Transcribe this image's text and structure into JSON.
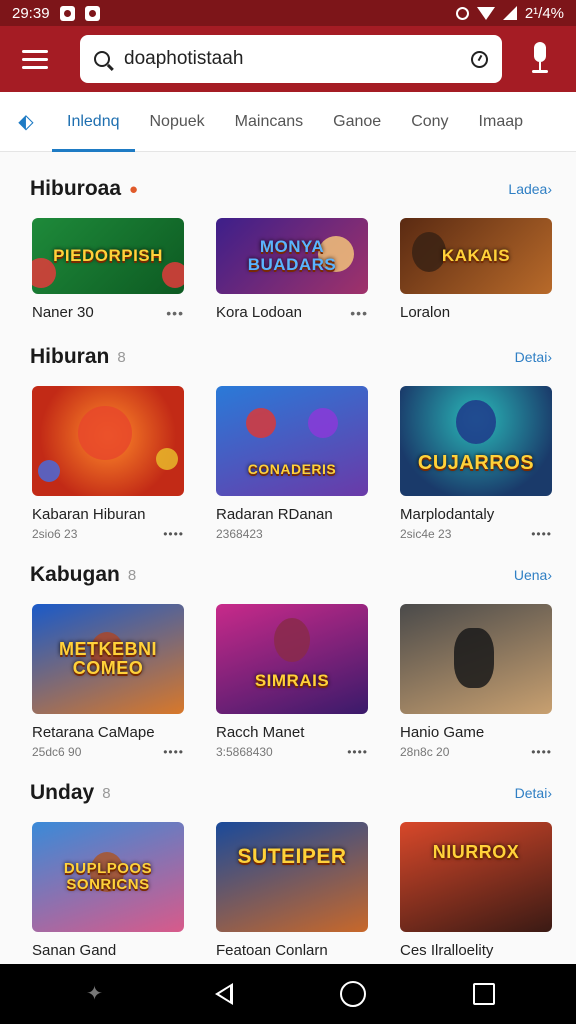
{
  "status": {
    "time": "29:39",
    "right_text": "2¹/4%"
  },
  "search": {
    "query": "doaphotistaah"
  },
  "tabs": [
    "Inlednq",
    "Nopuek",
    "Maincans",
    "Ganoe",
    "Cony",
    "Imaap"
  ],
  "sections": [
    {
      "title": "Hiburoaa",
      "link": "Ladea›",
      "cards": [
        {
          "title": "PIEDORPISH",
          "name": "Naner 30",
          "meta": ""
        },
        {
          "title": "MONYA BUADARS",
          "name": "Kora Lodoan",
          "meta": ""
        },
        {
          "title": "KAKAIS",
          "name": "Loralon",
          "meta": ""
        }
      ]
    },
    {
      "title": "Hiburan",
      "link": "Detai›",
      "cards": [
        {
          "title": "",
          "name": "Kabaran Hiburan",
          "meta": "2sio6 23"
        },
        {
          "title": "CONADERIS",
          "name": "Radaran RDanan",
          "meta": "2368423"
        },
        {
          "title": "CUJARROS",
          "name": "Marplodantaly",
          "meta": "2sic4e 23"
        }
      ]
    },
    {
      "title": "Kabugan",
      "link": "Uena›",
      "cards": [
        {
          "title": "METKEBNI COMEO",
          "name": "Retarana CaMape",
          "meta": "25dc6 90"
        },
        {
          "title": "SIMRAIS",
          "name": "Racch Manet",
          "meta": "3:5868430"
        },
        {
          "title": "",
          "name": "Hanio Game",
          "meta": "28n8c 20"
        }
      ]
    },
    {
      "title": "Unday",
      "link": "Detai›",
      "cards": [
        {
          "title": "DUPLPOOS SONRICNS",
          "name": "Sanan Gand",
          "meta": ""
        },
        {
          "title": "SUTEIPER",
          "name": "Featoan Conlarn",
          "meta": ""
        },
        {
          "title": "NIURROX",
          "name": "Ces Ilralloelity",
          "meta": ""
        }
      ]
    }
  ],
  "colors": {
    "appbar": "#a51c24",
    "statusbar": "#7d1519",
    "accent": "#1e7bc4"
  }
}
